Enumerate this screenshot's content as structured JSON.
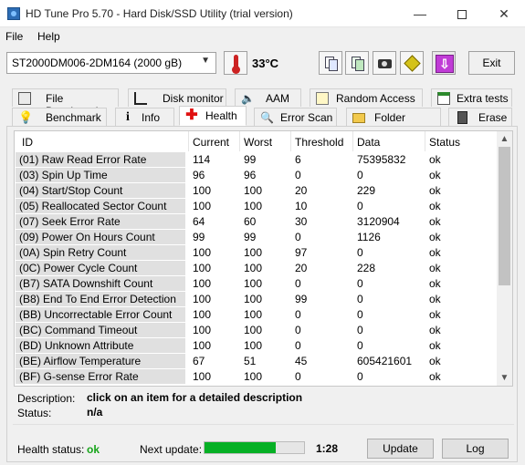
{
  "window": {
    "title": "HD Tune Pro 5.70 - Hard Disk/SSD Utility (trial version)",
    "minimize": "—",
    "close": "✕"
  },
  "menu": {
    "file": "File",
    "help": "Help"
  },
  "toolbar": {
    "drive": "ST2000DM006-2DM164 (2000 gB)",
    "temperature": "33°C",
    "exit_label": "Exit"
  },
  "tabs_top": [
    {
      "label": "File Benchmark",
      "icon": "file-benchmark-icon"
    },
    {
      "label": "Disk monitor",
      "icon": "disk-monitor-icon"
    },
    {
      "label": "AAM",
      "icon": "speaker-icon"
    },
    {
      "label": "Random Access",
      "icon": "random-access-icon"
    },
    {
      "label": "Extra tests",
      "icon": "extra-tests-icon"
    }
  ],
  "tabs_bottom": [
    {
      "label": "Benchmark",
      "icon": "benchmark-icon"
    },
    {
      "label": "Info",
      "icon": "info-icon"
    },
    {
      "label": "Health",
      "icon": "health-cross-icon",
      "active": true
    },
    {
      "label": "Error Scan",
      "icon": "magnifier-icon"
    },
    {
      "label": "Folder Usage",
      "icon": "folder-icon"
    },
    {
      "label": "Erase",
      "icon": "trash-icon"
    }
  ],
  "table": {
    "columns": [
      "ID",
      "Current",
      "Worst",
      "Threshold",
      "Data",
      "Status"
    ],
    "rows": [
      [
        "(01) Raw Read Error Rate",
        "114",
        "99",
        "6",
        "75395832",
        "ok"
      ],
      [
        "(03) Spin Up Time",
        "96",
        "96",
        "0",
        "0",
        "ok"
      ],
      [
        "(04) Start/Stop Count",
        "100",
        "100",
        "20",
        "229",
        "ok"
      ],
      [
        "(05) Reallocated Sector Count",
        "100",
        "100",
        "10",
        "0",
        "ok"
      ],
      [
        "(07) Seek Error Rate",
        "64",
        "60",
        "30",
        "3120904",
        "ok"
      ],
      [
        "(09) Power On Hours Count",
        "99",
        "99",
        "0",
        "1126",
        "ok"
      ],
      [
        "(0A) Spin Retry Count",
        "100",
        "100",
        "97",
        "0",
        "ok"
      ],
      [
        "(0C) Power Cycle Count",
        "100",
        "100",
        "20",
        "228",
        "ok"
      ],
      [
        "(B7) SATA Downshift Count",
        "100",
        "100",
        "0",
        "0",
        "ok"
      ],
      [
        "(B8) End To End Error Detection",
        "100",
        "100",
        "99",
        "0",
        "ok"
      ],
      [
        "(BB) Uncorrectable Error Count",
        "100",
        "100",
        "0",
        "0",
        "ok"
      ],
      [
        "(BC) Command Timeout",
        "100",
        "100",
        "0",
        "0",
        "ok"
      ],
      [
        "(BD) Unknown Attribute",
        "100",
        "100",
        "0",
        "0",
        "ok"
      ],
      [
        "(BE) Airflow Temperature",
        "67",
        "51",
        "45",
        "605421601",
        "ok"
      ],
      [
        "(BF) G-sense Error Rate",
        "100",
        "100",
        "0",
        "0",
        "ok"
      ]
    ]
  },
  "details": {
    "description_label": "Description:",
    "description_value": "click on an item for a detailed description",
    "status_label": "Status:",
    "status_value": "n/a"
  },
  "footer": {
    "health_label": "Health status:",
    "health_value": "ok",
    "next_update_label": "Next update:",
    "next_update_progress": 0.72,
    "next_update_time": "1:28",
    "update_button": "Update",
    "log_button": "Log"
  },
  "colors": {
    "health_ok": "#17a51a",
    "progress": "#06b025"
  }
}
